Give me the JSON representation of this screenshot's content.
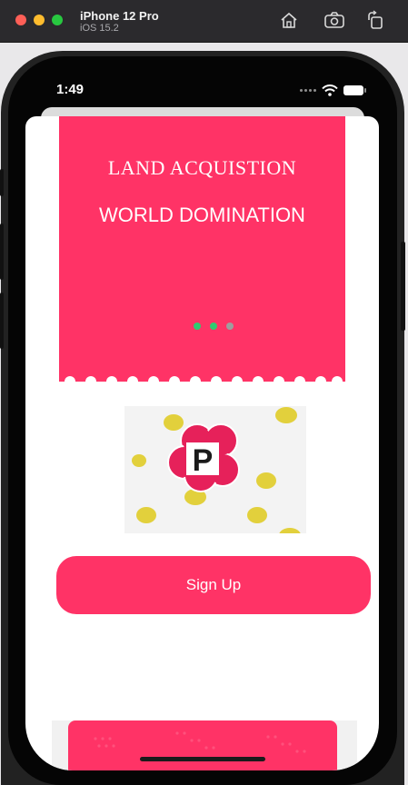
{
  "simulator": {
    "device_name": "iPhone 12 Pro",
    "os_version": "iOS 15.2",
    "icons": [
      "home-icon",
      "screenshot-icon",
      "rotate-icon"
    ]
  },
  "status_bar": {
    "time": "1:49",
    "icons": [
      "signal-dots-icon",
      "wifi-icon",
      "battery-icon"
    ]
  },
  "hero": {
    "title": "LAND ACQUISTION",
    "subtitle": "WORLD DOMINATION",
    "background_color": "#ff3366",
    "pager": {
      "page_count": 3,
      "dot_colors": [
        "#2ecc71",
        "#2ecc71",
        "#9e9e9e"
      ]
    }
  },
  "logo": {
    "letter": "P",
    "icon": "flower-logo-icon",
    "accent_color": "#e6215a",
    "dot_color": "#e2d03c"
  },
  "signup_button": {
    "label": "Sign Up",
    "color": "#ff3366"
  },
  "colors": {
    "accent": "#ff3366",
    "screen_background": "#ffffff"
  }
}
